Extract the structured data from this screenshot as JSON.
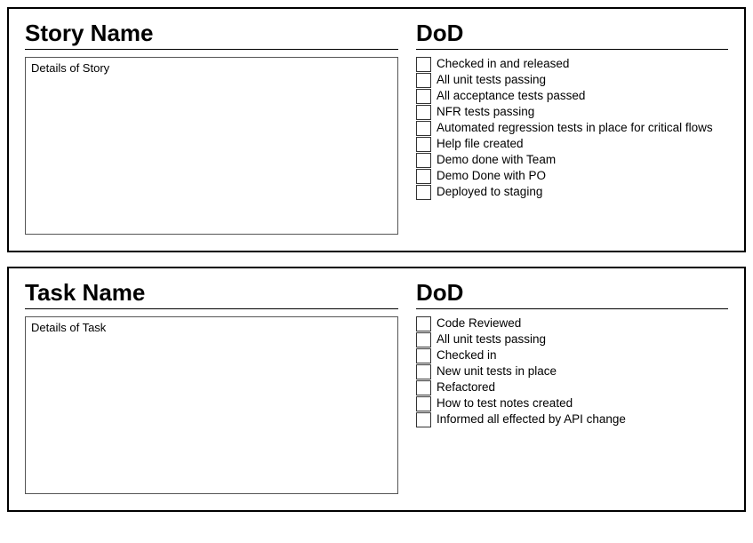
{
  "story": {
    "title": "Story Name",
    "details_label": "Details of Story",
    "dod_title": "DoD",
    "dod_items": [
      "Checked in and released",
      "All unit tests passing",
      "All acceptance tests passed",
      "NFR tests passing",
      "Automated regression tests in place for critical flows",
      "Help file created",
      "Demo done with Team",
      "Demo Done with PO",
      "Deployed to staging"
    ]
  },
  "task": {
    "title": "Task Name",
    "details_label": "Details of Task",
    "dod_title": "DoD",
    "dod_items": [
      "Code Reviewed",
      "All unit tests passing",
      "Checked in",
      "New unit tests in place",
      "Refactored",
      "How to test notes created",
      "Informed all effected by API change"
    ]
  }
}
